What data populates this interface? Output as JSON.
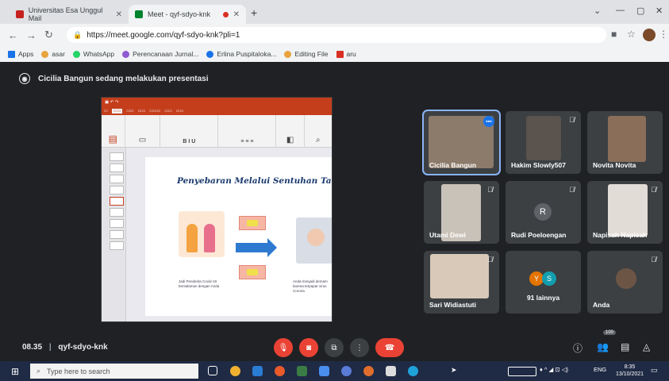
{
  "browser": {
    "tabs": [
      {
        "label": "Universitas Esa Unggul Mail"
      },
      {
        "label": "Meet - qyf-sdyo-knk"
      }
    ],
    "url": "https://meet.google.com/qyf-sdyo-knk?pli=1",
    "bookmarks": [
      "Apps",
      "asar",
      "WhatsApp",
      "Perencanaan Jurnal...",
      "Erlina Puspitaloka...",
      "Editing File",
      "aru"
    ]
  },
  "meet": {
    "presenting_text": "Cicilia Bangun sedang melakukan presentasi",
    "shared_slide": {
      "title": "Penyebaran Melalui Sentuhan Tangan",
      "caption_left": "Jadi Penderita Covid-19 bersalaman dengan Anda",
      "caption_right": "Anda menjadi demam karena terpapar virus Corona"
    },
    "participants": [
      {
        "name": "Cicilia Bangun"
      },
      {
        "name": "Hakim Slowly507"
      },
      {
        "name": "Novita Novita"
      },
      {
        "name": "Utami Dewi"
      },
      {
        "name": "Rudi Poeloengan",
        "initial": "R"
      },
      {
        "name": "Napisah Napisah"
      },
      {
        "name": "Sari Widiastuti"
      },
      {
        "name": "91 lainnya",
        "initials": [
          "Y",
          "S"
        ]
      },
      {
        "name": "Anda"
      }
    ],
    "time": "08.35",
    "meeting_code": "qyf-sdyo-knk",
    "people_count_badge": "100"
  },
  "taskbar": {
    "search_placeholder": "Type here to search",
    "language": "ENG",
    "clock_time": "8:35",
    "clock_date": "13/10/2021"
  }
}
